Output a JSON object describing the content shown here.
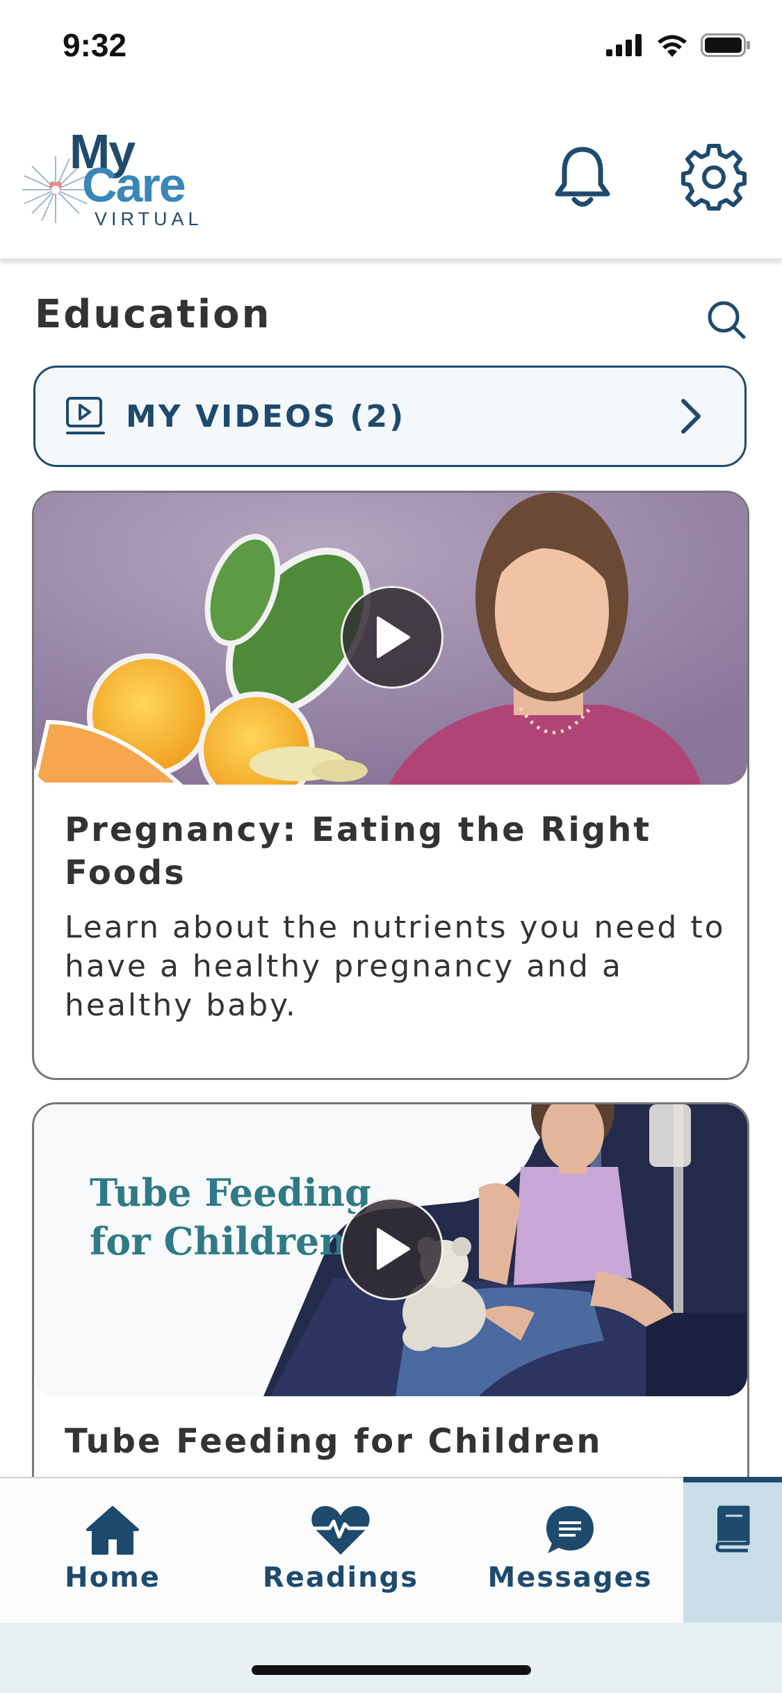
{
  "status_bar": {
    "time": "9:32"
  },
  "header": {
    "logo": {
      "line1": "My",
      "line2": "Care",
      "line3": "VIRTUAL"
    },
    "notifications_icon": "bell-icon",
    "settings_icon": "gear-icon"
  },
  "education": {
    "title": "Education",
    "search_icon": "search-icon",
    "my_videos": {
      "label": "MY VIDEOS (2)",
      "icon": "video-play-icon"
    }
  },
  "videos": [
    {
      "title": "Pregnancy: Eating the Right Foods",
      "description": "Learn about the nutrients you need to have a healthy pregnancy and a healthy baby."
    },
    {
      "title": "Tube Feeding for Children",
      "thumbnail_text_line1": "Tube Feeding",
      "thumbnail_text_line2": "for Children"
    }
  ],
  "tab_bar": {
    "items": [
      {
        "label": "Home",
        "icon": "home-icon"
      },
      {
        "label": "Readings",
        "icon": "heart-pulse-icon"
      },
      {
        "label": "Messages",
        "icon": "message-icon"
      },
      {
        "label": "",
        "icon": "book-icon",
        "active": true
      }
    ]
  },
  "colors": {
    "primary": "#1e4a6e",
    "accent": "#3a86b8",
    "active_tab_bg": "#c9dee8"
  }
}
